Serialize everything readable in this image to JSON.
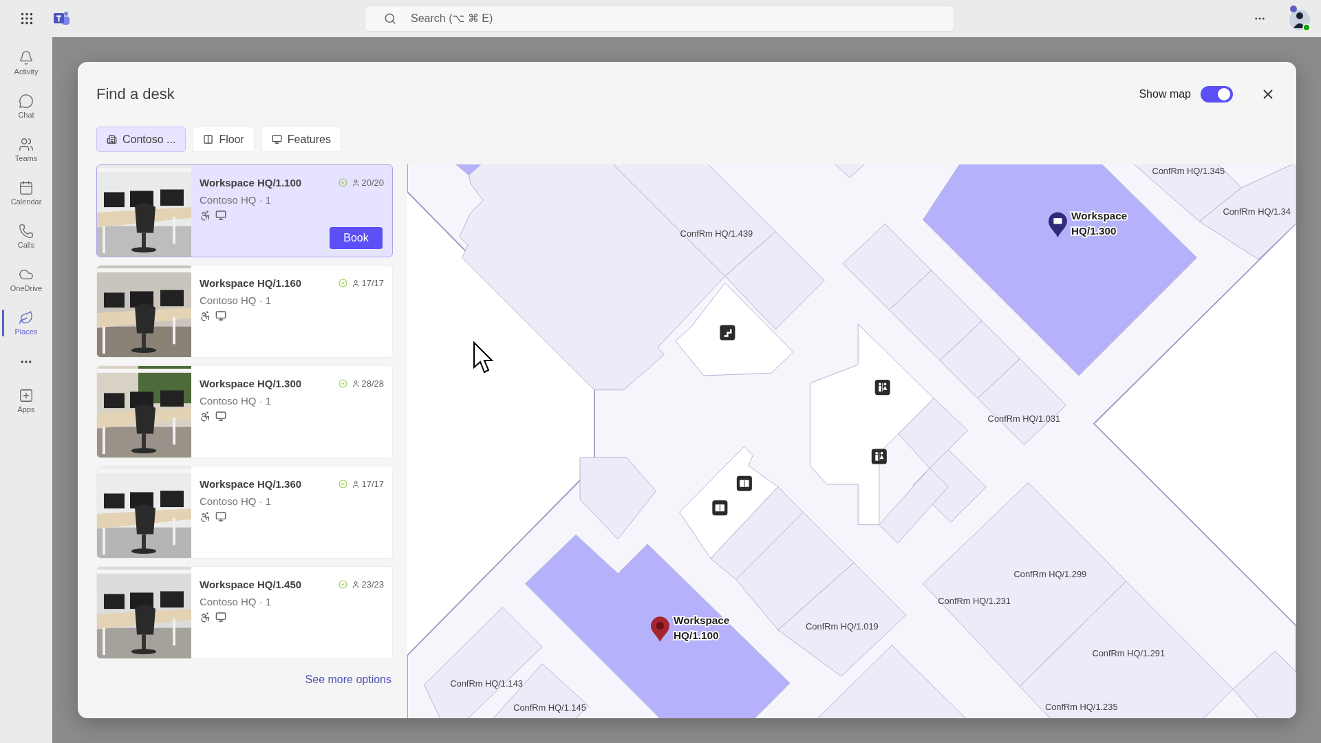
{
  "app_bar": {
    "search_placeholder": "Search (⌥ ⌘ E)"
  },
  "rail": [
    {
      "label": "Activity",
      "selected": false
    },
    {
      "label": "Chat",
      "selected": false
    },
    {
      "label": "Teams",
      "selected": false
    },
    {
      "label": "Calendar",
      "selected": false
    },
    {
      "label": "Calls",
      "selected": false
    },
    {
      "label": "OneDrive",
      "selected": false
    },
    {
      "label": "Places",
      "selected": true
    },
    {
      "label": "Apps",
      "selected": false
    }
  ],
  "dialog": {
    "title": "Find a desk",
    "show_map": {
      "label": "Show map",
      "on": true
    },
    "filters": [
      {
        "label": "Contoso ...",
        "selected": true
      },
      {
        "label": "Floor",
        "selected": false
      },
      {
        "label": "Features",
        "selected": false
      }
    ],
    "book_button": "Book",
    "results": [
      {
        "name": "Workspace HQ/1.100",
        "location": "Contoso HQ · 1",
        "capacity": "20/20",
        "selected": true
      },
      {
        "name": "Workspace HQ/1.160",
        "location": "Contoso HQ · 1",
        "capacity": "17/17",
        "selected": false
      },
      {
        "name": "Workspace HQ/1.300",
        "location": "Contoso HQ · 1",
        "capacity": "28/28",
        "selected": false
      },
      {
        "name": "Workspace HQ/1.360",
        "location": "Contoso HQ · 1",
        "capacity": "17/17",
        "selected": false
      },
      {
        "name": "Workspace HQ/1.450",
        "location": "Contoso HQ · 1",
        "capacity": "23/23",
        "selected": false
      }
    ],
    "see_more": "See more options",
    "map": {
      "room_labels": [
        "ConfRm HQ/1.439",
        "ConfRm HQ/1.345",
        "ConfRm HQ/1.34",
        "ConfRm HQ/1.031",
        "ConfRm HQ/1.299",
        "ConfRm HQ/1.231",
        "ConfRm HQ/1.019",
        "ConfRm HQ/1.291",
        "ConfRm HQ/1.143",
        "ConfRm HQ/1.145",
        "ConfRm HQ/1.235"
      ],
      "workspaces": [
        {
          "lines": [
            "Workspace",
            "HQ/1.300"
          ],
          "selected": false
        },
        {
          "lines": [
            "Workspace",
            "HQ/1.100"
          ],
          "selected": true
        }
      ]
    }
  }
}
